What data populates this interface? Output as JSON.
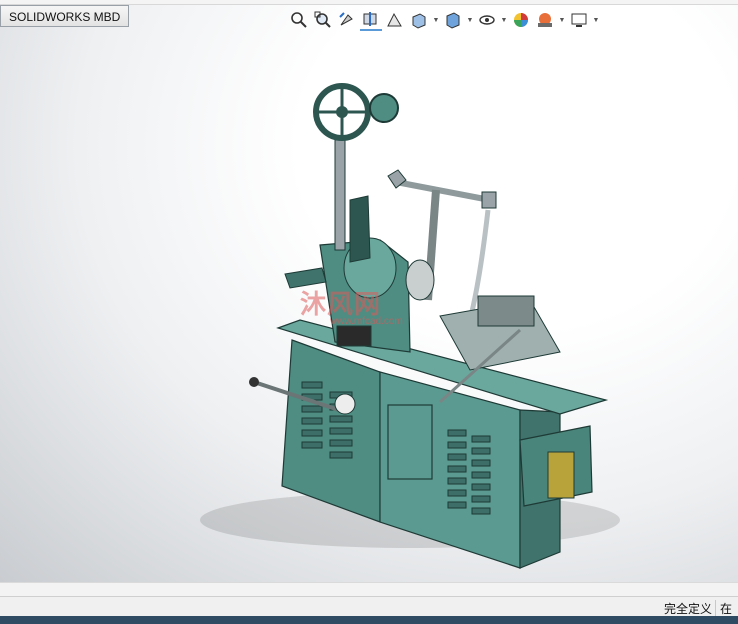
{
  "app": {
    "tab_label": "SOLIDWORKS MBD"
  },
  "hud_icons": [
    {
      "name": "zoom-to-fit-icon"
    },
    {
      "name": "zoom-to-area-icon"
    },
    {
      "name": "previous-view-icon"
    },
    {
      "name": "section-view-icon"
    },
    {
      "name": "dynamic-annotation-views-icon"
    },
    {
      "name": "view-orientation-icon"
    },
    {
      "name": "display-style-icon"
    },
    {
      "name": "hide-show-items-icon"
    },
    {
      "name": "edit-appearance-icon"
    },
    {
      "name": "apply-scene-icon"
    },
    {
      "name": "view-settings-icon"
    }
  ],
  "watermark": {
    "text": "沐风网",
    "url": "www.mfcad.com"
  },
  "status": {
    "definition_state": "完全定义",
    "edit_state": "在"
  },
  "colors": {
    "machine_body": "#4f8c82",
    "machine_dark": "#2d5650",
    "panel": "#b8a23a"
  }
}
